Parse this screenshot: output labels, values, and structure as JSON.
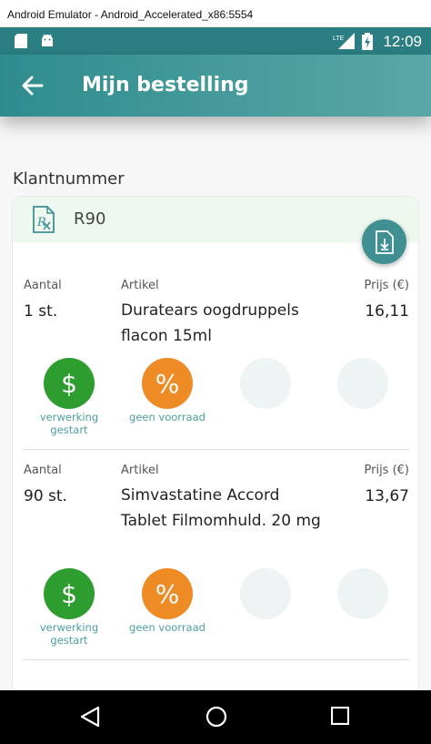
{
  "window": {
    "title": "Android Emulator - Android_Accelerated_x86:5554"
  },
  "statusbar": {
    "time": "12:09",
    "network": "LTE",
    "icons": [
      "sd-card-icon",
      "android-icon",
      "signal-icon",
      "battery-charging-icon"
    ]
  },
  "appbar": {
    "title": "Mijn bestelling",
    "back_icon": "arrow-left-icon"
  },
  "section": {
    "label": "Klantnummer"
  },
  "card": {
    "customer_number": "R90",
    "header_icon": "prescription-icon",
    "fab_icon": "document-download-icon"
  },
  "columns": {
    "quantity": "Aantal",
    "article": "Artikel",
    "price": "Prijs (€)"
  },
  "items": [
    {
      "quantity": "1 st.",
      "article": "Duratears oogdruppels flacon 15ml",
      "price": "16,11",
      "statuses": [
        {
          "symbol": "$",
          "line1": "verwerking",
          "line2": "gestart",
          "color": "#2d9d2f"
        },
        {
          "symbol": "%",
          "line1": "geen voorraad",
          "line2": "",
          "color": "#ef8b25"
        }
      ]
    },
    {
      "quantity": "90 st.",
      "article": "Simvastatine Accord Tablet Filmomhuld. 20 mg",
      "price": "13,67",
      "statuses": [
        {
          "symbol": "$",
          "line1": "verwerking",
          "line2": "gestart",
          "color": "#2d9d2f"
        },
        {
          "symbol": "%",
          "line1": "geen voorraad",
          "line2": "",
          "color": "#ef8b25"
        }
      ]
    }
  ],
  "navbar": {
    "icons": [
      "nav-back-icon",
      "nav-home-icon",
      "nav-recents-icon"
    ]
  }
}
